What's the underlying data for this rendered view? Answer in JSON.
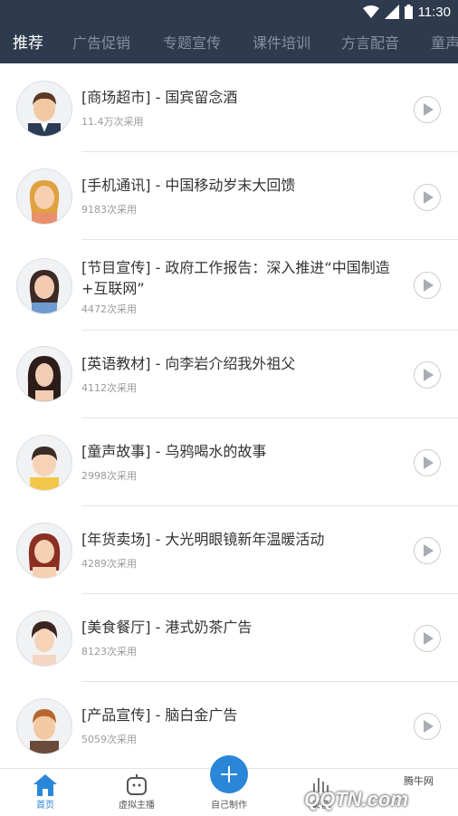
{
  "status": {
    "time": "11:30"
  },
  "tabs": [
    "推荐",
    "广告促销",
    "专题宣传",
    "课件培训",
    "方言配音",
    "童声"
  ],
  "items": [
    {
      "title": "[商场超市] - 国宾留念酒",
      "count": "11.4万次采用"
    },
    {
      "title": "[手机通讯] - 中国移动岁末大回馈",
      "count": "9183次采用"
    },
    {
      "title": "[节目宣传] - 政府工作报告：深入推进“中国制造+互联网”",
      "count": "4472次采用"
    },
    {
      "title": "[英语教材] - 向李岩介绍我外祖父",
      "count": "4112次采用"
    },
    {
      "title": "[童声故事] - 乌鸦喝水的故事",
      "count": "2998次采用"
    },
    {
      "title": "[年货卖场] - 大光明眼镜新年温暖活动",
      "count": "4289次采用"
    },
    {
      "title": "[美食餐厅] - 港式奶茶广告",
      "count": "8123次采用"
    },
    {
      "title": "[产品宣传] - 脑白金广告",
      "count": "5059次采用"
    }
  ],
  "nav": {
    "home": "首页",
    "virtual": "虚拟主播",
    "create": "自己制作",
    "fourth": "录音",
    "watermark_top": "腾牛网",
    "watermark_bottom": "QQTN.com"
  },
  "colors": {
    "header": "#2e3a4d",
    "accent": "#2a86d8"
  }
}
